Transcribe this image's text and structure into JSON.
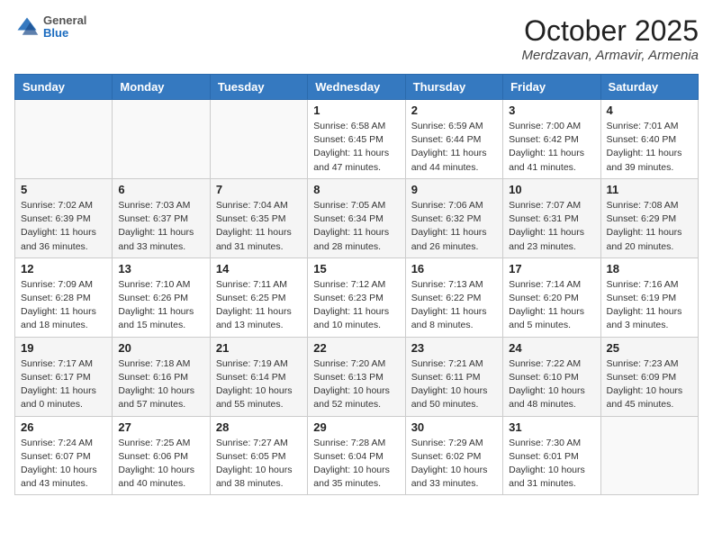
{
  "header": {
    "logo_general": "General",
    "logo_blue": "Blue",
    "month_title": "October 2025",
    "location": "Merdzavan, Armavir, Armenia"
  },
  "weekdays": [
    "Sunday",
    "Monday",
    "Tuesday",
    "Wednesday",
    "Thursday",
    "Friday",
    "Saturday"
  ],
  "weeks": [
    [
      {
        "day": "",
        "sunrise": "",
        "sunset": "",
        "daylight": ""
      },
      {
        "day": "",
        "sunrise": "",
        "sunset": "",
        "daylight": ""
      },
      {
        "day": "",
        "sunrise": "",
        "sunset": "",
        "daylight": ""
      },
      {
        "day": "1",
        "sunrise": "Sunrise: 6:58 AM",
        "sunset": "Sunset: 6:45 PM",
        "daylight": "Daylight: 11 hours and 47 minutes."
      },
      {
        "day": "2",
        "sunrise": "Sunrise: 6:59 AM",
        "sunset": "Sunset: 6:44 PM",
        "daylight": "Daylight: 11 hours and 44 minutes."
      },
      {
        "day": "3",
        "sunrise": "Sunrise: 7:00 AM",
        "sunset": "Sunset: 6:42 PM",
        "daylight": "Daylight: 11 hours and 41 minutes."
      },
      {
        "day": "4",
        "sunrise": "Sunrise: 7:01 AM",
        "sunset": "Sunset: 6:40 PM",
        "daylight": "Daylight: 11 hours and 39 minutes."
      }
    ],
    [
      {
        "day": "5",
        "sunrise": "Sunrise: 7:02 AM",
        "sunset": "Sunset: 6:39 PM",
        "daylight": "Daylight: 11 hours and 36 minutes."
      },
      {
        "day": "6",
        "sunrise": "Sunrise: 7:03 AM",
        "sunset": "Sunset: 6:37 PM",
        "daylight": "Daylight: 11 hours and 33 minutes."
      },
      {
        "day": "7",
        "sunrise": "Sunrise: 7:04 AM",
        "sunset": "Sunset: 6:35 PM",
        "daylight": "Daylight: 11 hours and 31 minutes."
      },
      {
        "day": "8",
        "sunrise": "Sunrise: 7:05 AM",
        "sunset": "Sunset: 6:34 PM",
        "daylight": "Daylight: 11 hours and 28 minutes."
      },
      {
        "day": "9",
        "sunrise": "Sunrise: 7:06 AM",
        "sunset": "Sunset: 6:32 PM",
        "daylight": "Daylight: 11 hours and 26 minutes."
      },
      {
        "day": "10",
        "sunrise": "Sunrise: 7:07 AM",
        "sunset": "Sunset: 6:31 PM",
        "daylight": "Daylight: 11 hours and 23 minutes."
      },
      {
        "day": "11",
        "sunrise": "Sunrise: 7:08 AM",
        "sunset": "Sunset: 6:29 PM",
        "daylight": "Daylight: 11 hours and 20 minutes."
      }
    ],
    [
      {
        "day": "12",
        "sunrise": "Sunrise: 7:09 AM",
        "sunset": "Sunset: 6:28 PM",
        "daylight": "Daylight: 11 hours and 18 minutes."
      },
      {
        "day": "13",
        "sunrise": "Sunrise: 7:10 AM",
        "sunset": "Sunset: 6:26 PM",
        "daylight": "Daylight: 11 hours and 15 minutes."
      },
      {
        "day": "14",
        "sunrise": "Sunrise: 7:11 AM",
        "sunset": "Sunset: 6:25 PM",
        "daylight": "Daylight: 11 hours and 13 minutes."
      },
      {
        "day": "15",
        "sunrise": "Sunrise: 7:12 AM",
        "sunset": "Sunset: 6:23 PM",
        "daylight": "Daylight: 11 hours and 10 minutes."
      },
      {
        "day": "16",
        "sunrise": "Sunrise: 7:13 AM",
        "sunset": "Sunset: 6:22 PM",
        "daylight": "Daylight: 11 hours and 8 minutes."
      },
      {
        "day": "17",
        "sunrise": "Sunrise: 7:14 AM",
        "sunset": "Sunset: 6:20 PM",
        "daylight": "Daylight: 11 hours and 5 minutes."
      },
      {
        "day": "18",
        "sunrise": "Sunrise: 7:16 AM",
        "sunset": "Sunset: 6:19 PM",
        "daylight": "Daylight: 11 hours and 3 minutes."
      }
    ],
    [
      {
        "day": "19",
        "sunrise": "Sunrise: 7:17 AM",
        "sunset": "Sunset: 6:17 PM",
        "daylight": "Daylight: 11 hours and 0 minutes."
      },
      {
        "day": "20",
        "sunrise": "Sunrise: 7:18 AM",
        "sunset": "Sunset: 6:16 PM",
        "daylight": "Daylight: 10 hours and 57 minutes."
      },
      {
        "day": "21",
        "sunrise": "Sunrise: 7:19 AM",
        "sunset": "Sunset: 6:14 PM",
        "daylight": "Daylight: 10 hours and 55 minutes."
      },
      {
        "day": "22",
        "sunrise": "Sunrise: 7:20 AM",
        "sunset": "Sunset: 6:13 PM",
        "daylight": "Daylight: 10 hours and 52 minutes."
      },
      {
        "day": "23",
        "sunrise": "Sunrise: 7:21 AM",
        "sunset": "Sunset: 6:11 PM",
        "daylight": "Daylight: 10 hours and 50 minutes."
      },
      {
        "day": "24",
        "sunrise": "Sunrise: 7:22 AM",
        "sunset": "Sunset: 6:10 PM",
        "daylight": "Daylight: 10 hours and 48 minutes."
      },
      {
        "day": "25",
        "sunrise": "Sunrise: 7:23 AM",
        "sunset": "Sunset: 6:09 PM",
        "daylight": "Daylight: 10 hours and 45 minutes."
      }
    ],
    [
      {
        "day": "26",
        "sunrise": "Sunrise: 7:24 AM",
        "sunset": "Sunset: 6:07 PM",
        "daylight": "Daylight: 10 hours and 43 minutes."
      },
      {
        "day": "27",
        "sunrise": "Sunrise: 7:25 AM",
        "sunset": "Sunset: 6:06 PM",
        "daylight": "Daylight: 10 hours and 40 minutes."
      },
      {
        "day": "28",
        "sunrise": "Sunrise: 7:27 AM",
        "sunset": "Sunset: 6:05 PM",
        "daylight": "Daylight: 10 hours and 38 minutes."
      },
      {
        "day": "29",
        "sunrise": "Sunrise: 7:28 AM",
        "sunset": "Sunset: 6:04 PM",
        "daylight": "Daylight: 10 hours and 35 minutes."
      },
      {
        "day": "30",
        "sunrise": "Sunrise: 7:29 AM",
        "sunset": "Sunset: 6:02 PM",
        "daylight": "Daylight: 10 hours and 33 minutes."
      },
      {
        "day": "31",
        "sunrise": "Sunrise: 7:30 AM",
        "sunset": "Sunset: 6:01 PM",
        "daylight": "Daylight: 10 hours and 31 minutes."
      },
      {
        "day": "",
        "sunrise": "",
        "sunset": "",
        "daylight": ""
      }
    ]
  ]
}
